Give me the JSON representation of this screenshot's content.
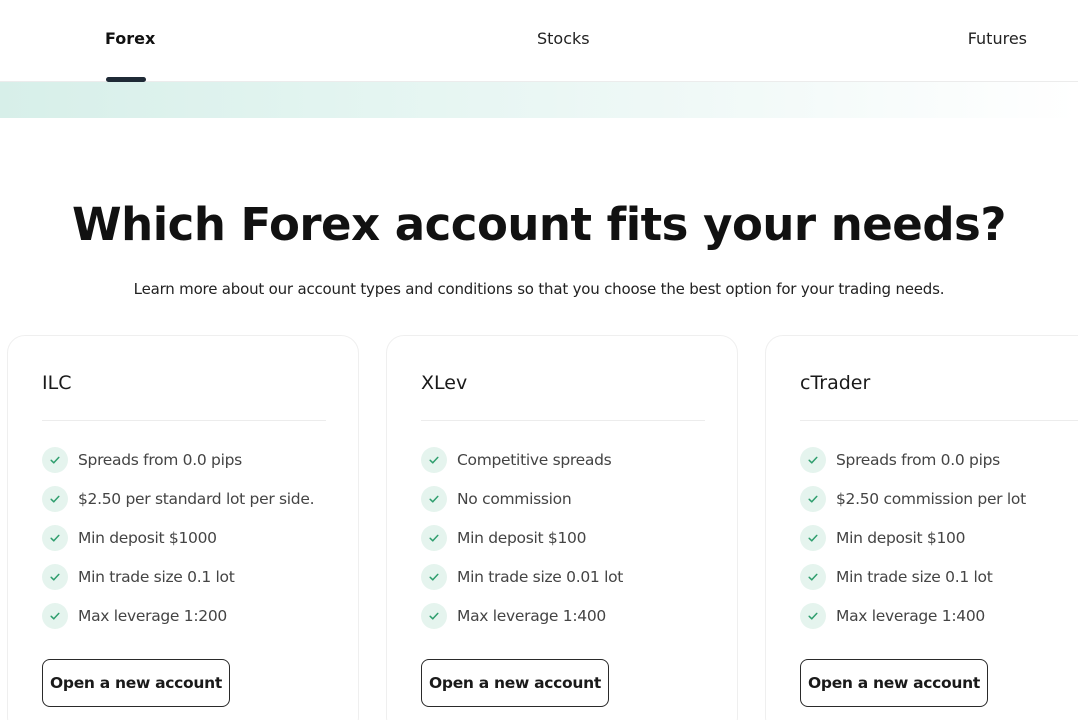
{
  "tabs": {
    "items": [
      {
        "label": "Forex",
        "active": true
      },
      {
        "label": "Stocks",
        "active": false
      },
      {
        "label": "Futures",
        "active": false
      }
    ]
  },
  "hero": {
    "title": "Which Forex account fits your needs?",
    "subtitle": "Learn more about our account types and conditions so that you choose the best option for your trading needs."
  },
  "colors": {
    "accent_dark": "#1f2a36",
    "check_bg": "#e5f4ee",
    "check_stroke": "#2f9e6e",
    "band_start": "#d7efe9"
  },
  "icons": {
    "feature": "check-icon"
  },
  "cards": [
    {
      "title": "ILC",
      "features": [
        "Spreads from 0.0 pips",
        "$2.50 per standard lot per side.",
        "Min deposit $1000",
        "Min trade size 0.1 lot",
        "Max leverage 1:200"
      ],
      "button": "Open a new account"
    },
    {
      "title": "XLev",
      "features": [
        "Competitive spreads",
        "No commission",
        "Min deposit $100",
        "Min trade size 0.01 lot",
        "Max leverage 1:400"
      ],
      "button": "Open a new account"
    },
    {
      "title": "cTrader",
      "features": [
        "Spreads from 0.0 pips",
        "$2.50 commission per lot",
        "Min deposit $100",
        "Min trade size 0.1 lot",
        "Max leverage 1:400"
      ],
      "button": "Open a new account"
    }
  ]
}
